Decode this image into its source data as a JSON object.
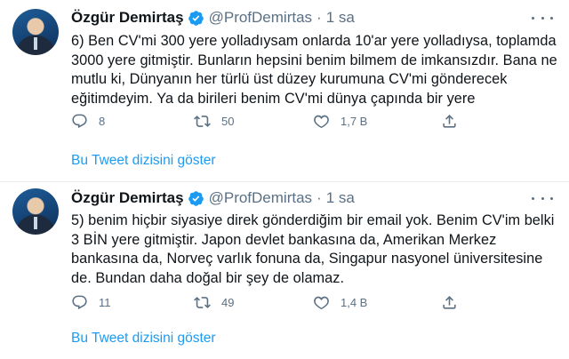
{
  "tweets": [
    {
      "author_name": "Özgür Demirtaş",
      "handle": "@ProfDemirtas",
      "separator": "·",
      "time": "1 sa",
      "text": "6) Ben CV'mi 300 yere yolladıysam onlarda 10'ar yere yolladıysa, toplamda 3000 yere gitmiştir. Bunların hepsini benim bilmem de imkansızdır. Bana ne mutlu ki, Dünyanın her türlü üst düzey kurumuna CV'mi gönderecek eğitimdeyim. Ya da birileri benim CV'mi dünya çapında bir yere",
      "replies": "8",
      "retweets": "50",
      "likes": "1,7 B",
      "thread_link": "Bu Tweet dizisini göster"
    },
    {
      "author_name": "Özgür Demirtaş",
      "handle": "@ProfDemirtas",
      "separator": "·",
      "time": "1 sa",
      "text": "5) benim hiçbir siyasiye direk gönderdiğim bir email yok. Benim CV'im belki 3 BİN yere gitmiştir. Japon devlet bankasına da, Amerikan Merkez bankasına da, Norveç varlık fonuna da, Singapur nasyonel üniversitesine de. Bundan daha doğal bir şey de olamaz.",
      "replies": "11",
      "retweets": "49",
      "likes": "1,4 B",
      "thread_link": "Bu Tweet dizisini göster"
    }
  ],
  "icons": {
    "verified": "verified-badge-icon",
    "more": "more-icon",
    "reply": "reply-icon",
    "retweet": "retweet-icon",
    "like": "like-icon",
    "share": "share-icon"
  },
  "colors": {
    "accent": "#1d9bf0",
    "secondary_text": "#5b7083",
    "divider": "#e6ecf0"
  }
}
